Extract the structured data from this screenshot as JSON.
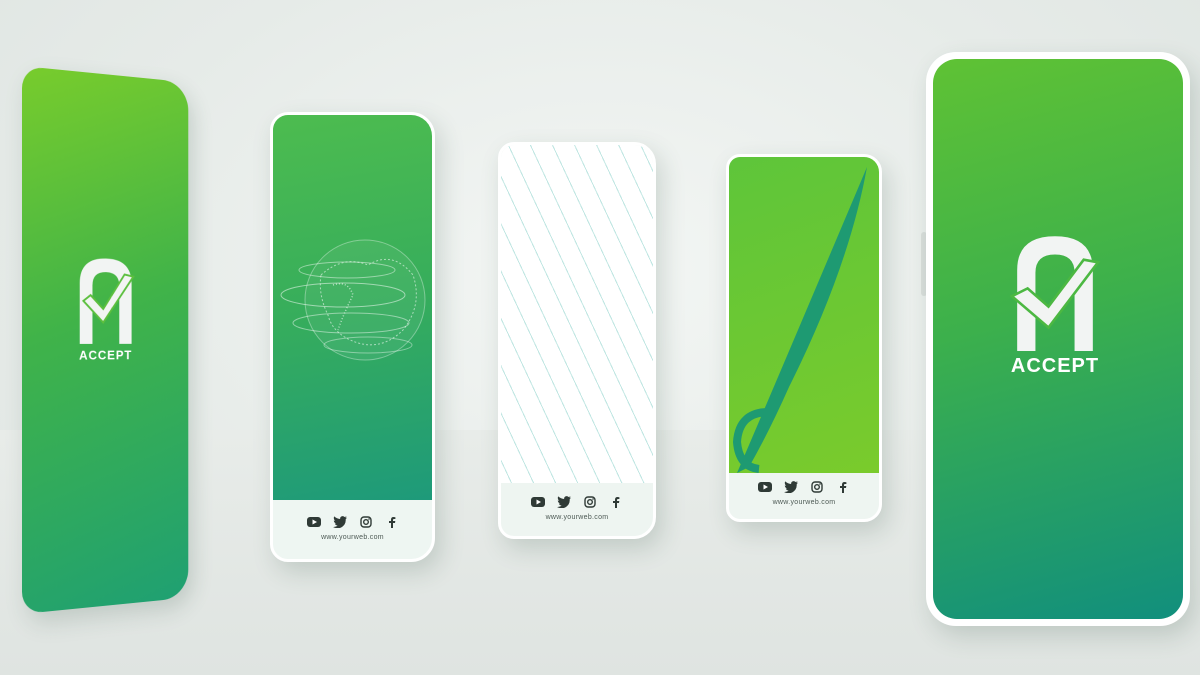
{
  "brand": {
    "word": "ACCEPT"
  },
  "footer": {
    "url": "www.yourweb.com"
  },
  "icons": [
    "youtube-icon",
    "twitter-icon",
    "instagram-icon",
    "facebook-icon"
  ],
  "colors": {
    "green_light": "#78cc2c",
    "green": "#3cb04c",
    "teal": "#118f7d",
    "footer_bg": "#eef6f2"
  }
}
